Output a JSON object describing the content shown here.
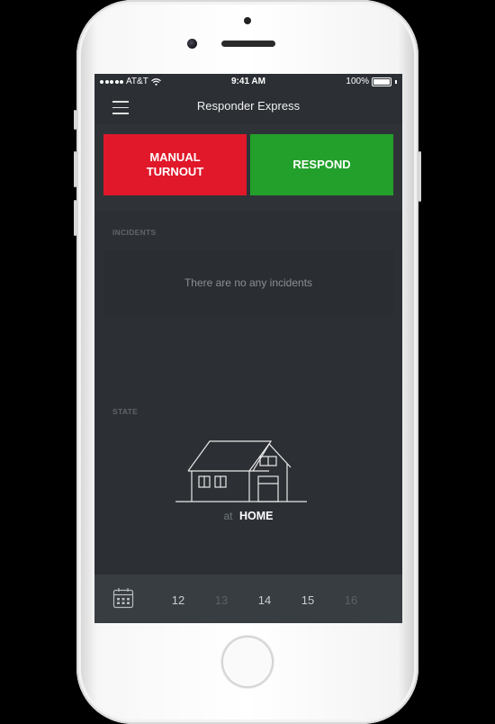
{
  "status_bar": {
    "carrier": "AT&T",
    "time": "9:41 AM",
    "battery": "100%"
  },
  "navbar": {
    "title": "Responder Express",
    "menu_icon": "hamburger-menu-icon"
  },
  "actions": {
    "manual_turnout_label": "MANUAL\nTURNOUT",
    "respond_label": "RESPOND",
    "colors": {
      "manual": "#e0182a",
      "respond": "#23a02b"
    }
  },
  "incidents": {
    "section_label": "INCIDENTS",
    "empty_text": "There are no any incidents"
  },
  "state": {
    "section_label": "STATE",
    "prefix": "at",
    "value": "HOME",
    "icon": "house-icon"
  },
  "date_strip": {
    "icon": "calendar-icon",
    "dates": [
      {
        "label": "12",
        "active": true
      },
      {
        "label": "13",
        "active": false
      },
      {
        "label": "14",
        "active": true
      },
      {
        "label": "15",
        "active": true
      },
      {
        "label": "16",
        "active": false
      }
    ]
  }
}
